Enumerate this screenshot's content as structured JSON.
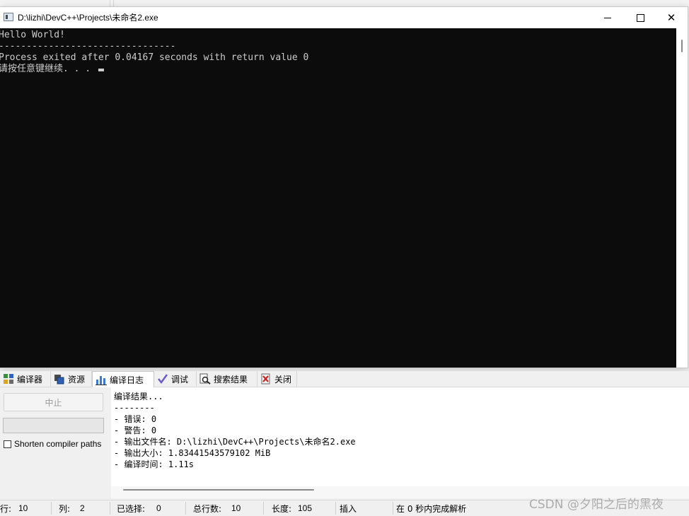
{
  "console_window": {
    "title": "D:\\lizhi\\DevC++\\Projects\\未命名2.exe",
    "lines": [
      "Hello World!",
      "--------------------------------",
      "Process exited after 0.04167 seconds with return value 0",
      "请按任意键继续. . . "
    ]
  },
  "tabs": [
    {
      "label": "编译器",
      "icon": "compiler-icon"
    },
    {
      "label": "资源",
      "icon": "resources-icon"
    },
    {
      "label": "编译日志",
      "icon": "compile-log-icon"
    },
    {
      "label": "调试",
      "icon": "debug-icon"
    },
    {
      "label": "搜索结果",
      "icon": "search-results-icon"
    },
    {
      "label": "关闭",
      "icon": "close-panel-icon"
    }
  ],
  "left_panel": {
    "stop_label": "中止",
    "shorten_label": "Shorten compiler paths",
    "shorten_checked": false
  },
  "log_lines": [
    "编译结果...",
    "--------",
    "- 错误: 0",
    "- 警告: 0",
    "- 输出文件名: D:\\lizhi\\DevC++\\Projects\\未命名2.exe",
    "- 输出大小: 1.83441543579102 MiB",
    "- 编译时间: 1.11s"
  ],
  "status": {
    "row_label": "行:",
    "row_value": "10",
    "col_label": "列:",
    "col_value": "2",
    "selected_label": "已选择:",
    "selected_value": "0",
    "total_label": "总行数:",
    "total_value": "10",
    "length_label": "长度:",
    "length_value": "105",
    "mode": "插入",
    "parse_info": "在 0 秒内完成解析"
  },
  "watermark": "CSDN @夕阳之后的黑夜",
  "colors": {
    "console_bg": "#0c0c0c",
    "console_text": "#cccccc"
  }
}
